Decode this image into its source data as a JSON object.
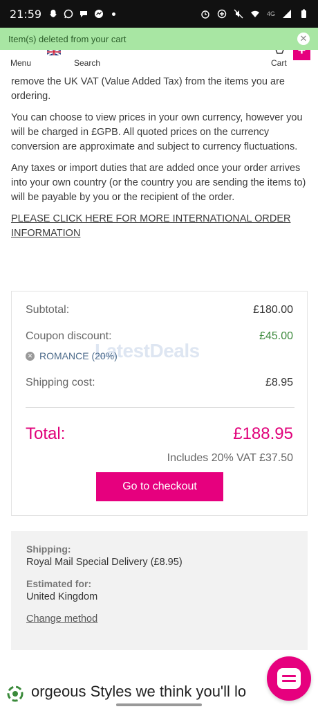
{
  "status_bar": {
    "time": "21:59",
    "network": "4G"
  },
  "notification": {
    "text": "Item(s) deleted from your cart"
  },
  "header": {
    "menu_label": "Menu",
    "search_label": "Search",
    "cart_label": "Cart"
  },
  "content": {
    "p1": "remove the UK VAT (Value Added Tax) from the items you are ordering.",
    "p2": "You can choose to view prices in your own currency, however you will be charged in £GPB. All quoted prices on the currency conversion are approximate and subject to currency fluctuations.",
    "p3": "Any taxes or import duties that are added once your order arrives into your own country (or the country you are sending the items to) will be payable by you or the recipient of the order.",
    "link": "PLEASE CLICK HERE FOR MORE INTERNATIONAL ORDER INFORMATION"
  },
  "summary": {
    "subtotal_label": "Subtotal:",
    "subtotal_value": "£180.00",
    "coupon_label": "Coupon discount:",
    "coupon_value": "£45.00",
    "coupon_code": "ROMANCE (20%)",
    "shipping_label": "Shipping cost:",
    "shipping_value": "£8.95",
    "total_label": "Total:",
    "total_value": "£188.95",
    "vat_text": "Includes 20% VAT £37.50",
    "checkout_label": "Go to checkout",
    "watermark": "LatestDeals"
  },
  "shipping_panel": {
    "shipping_heading": "Shipping:",
    "shipping_value": "Royal Mail Special Delivery (£8.95)",
    "estimated_heading": "Estimated for:",
    "estimated_value": "United Kingdom",
    "change_label": "Change method"
  },
  "bottom": {
    "teaser": "orgeous Styles we think you'll lo"
  },
  "colors": {
    "accent": "#e6007e",
    "notify_bg": "#a8e6a3",
    "discount_green": "#3d8a3d"
  }
}
